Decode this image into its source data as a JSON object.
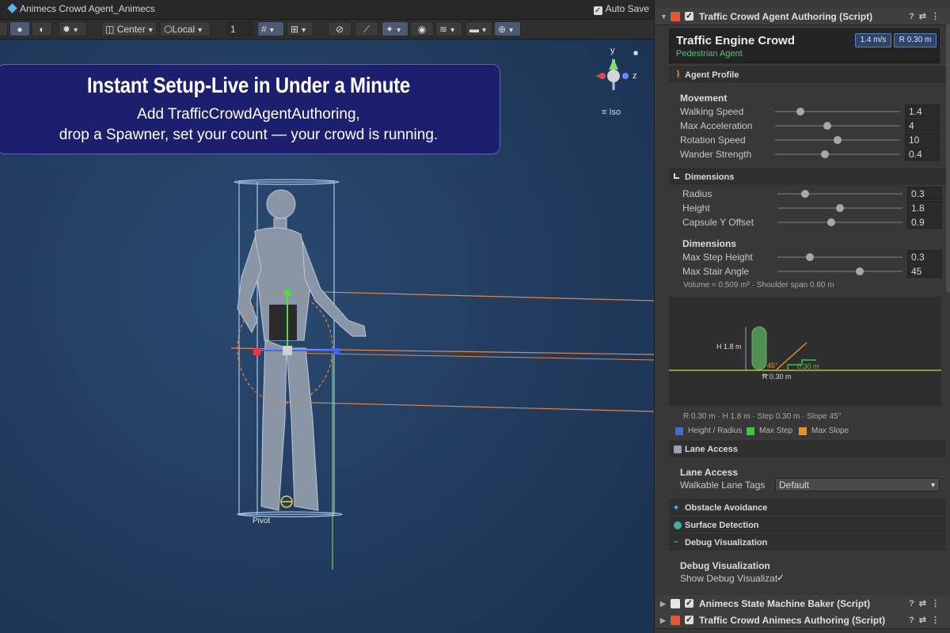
{
  "scene": {
    "window_title": "Animecs Crowd Agent_Animecs",
    "autosave_label": "Auto Save",
    "toolbar": {
      "pivot_mode": "Center",
      "space_mode": "Local",
      "grid_value": "1"
    },
    "gizmo": {
      "axis_y": "y",
      "axis_z": "z",
      "projection": "≡ Iso"
    },
    "pivot_label": "Pivot",
    "banner": {
      "title": "Instant Setup-Live in Under a Minute",
      "line1": "Add TrafficCrowdAgentAuthoring,",
      "line2": "drop a Spawner, set your count — your crowd is running."
    }
  },
  "inspector": {
    "component_title": "Traffic Crowd Agent Authoring (Script)",
    "card": {
      "title": "Traffic Engine Crowd",
      "subtitle": "Pedestrian Agent",
      "pill_speed": "1.4 m/s",
      "pill_radius": "R 0.30 m"
    },
    "agent_profile": {
      "title": "Agent Profile",
      "group": "Movement",
      "rows": [
        {
          "label": "Walking Speed",
          "value": "1.4",
          "fraction": 0.2
        },
        {
          "label": "Max Acceleration",
          "value": "4",
          "fraction": 0.42
        },
        {
          "label": "Rotation Speed",
          "value": "10",
          "fraction": 0.5
        },
        {
          "label": "Wander Strength",
          "value": "0.4",
          "fraction": 0.4
        }
      ]
    },
    "dimensions": {
      "title": "Dimensions",
      "rows": [
        {
          "label": "Radius",
          "value": "0.3",
          "fraction": 0.22
        },
        {
          "label": "Height",
          "value": "1.8",
          "fraction": 0.5
        },
        {
          "label": "Capsule Y Offset",
          "value": "0.9",
          "fraction": 0.43
        }
      ],
      "group2": "Dimensions",
      "rows2": [
        {
          "label": "Max Step Height",
          "value": "0.3",
          "fraction": 0.26
        },
        {
          "label": "Max Stair Angle",
          "value": "45",
          "fraction": 0.66
        }
      ],
      "volume_note": "Volume ≈ 0.509 m³  ·  Shoulder span 0.60 m",
      "diagram": {
        "height_label": "H 1.8 m",
        "radius_label": "R 0.30 m",
        "angle_label": "45°",
        "step_label": "0.30 m"
      },
      "summary": "R 0.30 m  ·  H 1.8 m  ·  Step 0.30 m  ·  Slope 45°",
      "legend": [
        {
          "label": "Height / Radius",
          "color": "#3f6fc9"
        },
        {
          "label": "Max Step",
          "color": "#43c43b"
        },
        {
          "label": "Max Slope",
          "color": "#e8902b"
        }
      ]
    },
    "lane_access": {
      "title": "Lane Access",
      "group": "Lane Access",
      "field_label": "Walkable Lane Tags",
      "field_value": "Default"
    },
    "obstacle_title": "Obstacle Avoidance",
    "surface_title": "Surface Detection",
    "debug": {
      "title": "Debug Visualization",
      "group": "Debug Visualization",
      "field_label": "Show Debug Visualizat",
      "checked": "✓"
    },
    "other_components": [
      "Animecs State Machine Baker (Script)",
      "Traffic Crowd Animecs Authoring (Script)"
    ]
  }
}
